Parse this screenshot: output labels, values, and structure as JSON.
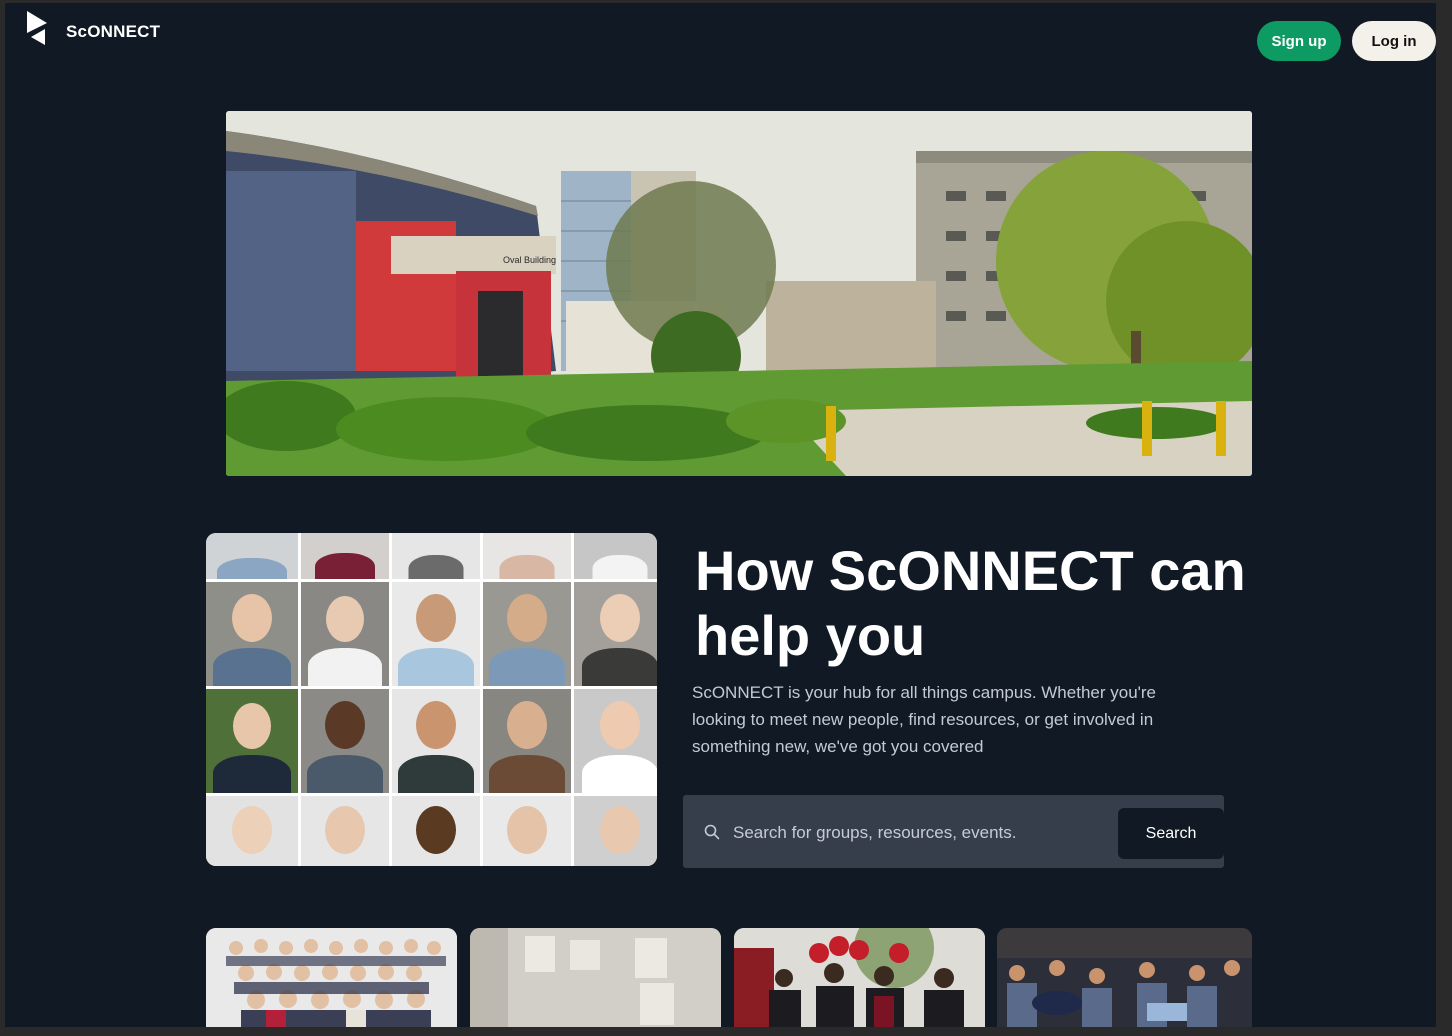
{
  "header": {
    "brand": "ScONNECT",
    "signup_label": "Sign up",
    "login_label": "Log in"
  },
  "main": {
    "headline": "How ScONNECT can help you",
    "description": "ScONNECT is your hub for all things campus. Whether you're looking to meet new people, find resources, or get involved in something new, we've got you covered",
    "search": {
      "placeholder": "Search for groups, resources, events.",
      "value": "",
      "button_label": "Search"
    }
  },
  "colors": {
    "background": "#111a24",
    "signup": "#0e9b63",
    "login": "#f4f1ea",
    "search_bar": "#363d4b"
  },
  "hero_building_sign": "Oval Building"
}
